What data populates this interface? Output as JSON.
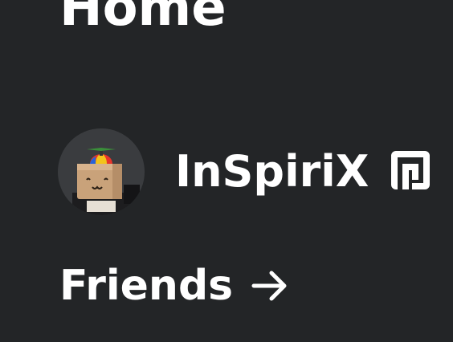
{
  "header": {
    "title": "Home"
  },
  "profile": {
    "username": "InSpiriX",
    "avatar_icon": "avatar-image",
    "badge_icon": "premium-icon"
  },
  "friends": {
    "label": "Friends",
    "arrow_icon": "arrow-right-icon"
  },
  "colors": {
    "background": "#232527",
    "text": "#ffffff",
    "avatar_bg": "#3a3c3f"
  }
}
